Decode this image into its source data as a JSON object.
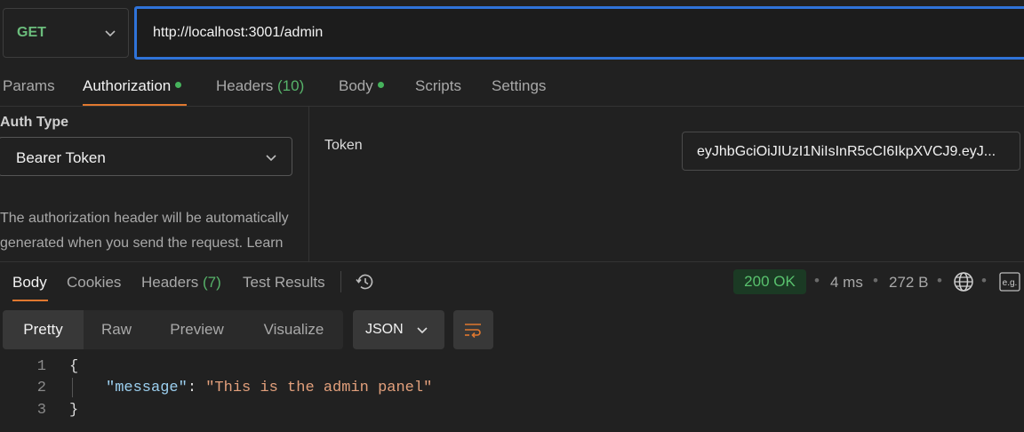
{
  "request": {
    "method": "GET",
    "url": "http://localhost:3001/admin"
  },
  "request_tabs": [
    {
      "label": "Params"
    },
    {
      "label": "Authorization",
      "dot": true,
      "active": true
    },
    {
      "label": "Headers",
      "count": "(10)"
    },
    {
      "label": "Body",
      "dot": true
    },
    {
      "label": "Scripts"
    },
    {
      "label": "Settings"
    }
  ],
  "auth": {
    "type_label": "Auth Type",
    "type_value": "Bearer Token",
    "description": "The authorization header will be automatically generated when you send the request. Learn more about",
    "token_label": "Token",
    "token_value": "eyJhbGciOiJIUzI1NiIsInR5cCI6IkpXVCJ9.eyJ..."
  },
  "response_tabs": [
    {
      "label": "Body",
      "active": true
    },
    {
      "label": "Cookies"
    },
    {
      "label": "Headers",
      "count": "(7)"
    },
    {
      "label": "Test Results"
    }
  ],
  "response_meta": {
    "status": "200 OK",
    "time": "4 ms",
    "size": "272 B",
    "bullet": "•"
  },
  "view_modes": [
    "Pretty",
    "Raw",
    "Preview",
    "Visualize"
  ],
  "format": "JSON",
  "code": {
    "lines": [
      "1",
      "2",
      "3"
    ],
    "open": "{",
    "key": "\"message\"",
    "colon": ":",
    "value": "\"This is the admin panel\"",
    "close": "}"
  },
  "colors": {
    "accent_blue": "#2f73d9",
    "accent_orange": "#e0782f",
    "success_green": "#59c26e"
  },
  "icons": [
    "chevron-down-icon",
    "history-icon",
    "globe-icon",
    "e.g.-icon",
    "wrap-icon"
  ]
}
